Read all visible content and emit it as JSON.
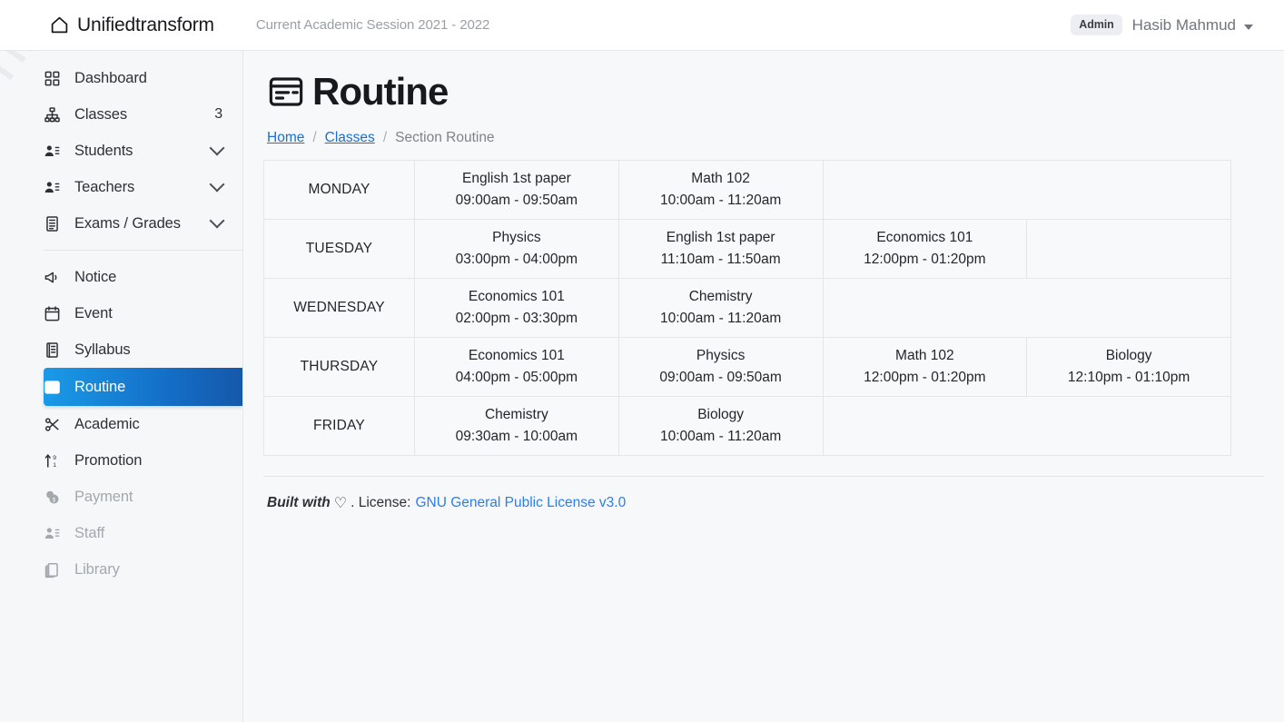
{
  "navbar": {
    "brand": "Unifiedtransform",
    "brand_icon": "home-icon",
    "session": "Current Academic Session 2021 - 2022",
    "role_badge": "Admin",
    "user_name": "Hasib Mahmud",
    "caret_icon": "chevron-down-icon"
  },
  "sidebar": {
    "watermark": "Unifiedtransform",
    "items": [
      {
        "label": "Dashboard",
        "icon": "grid-icon",
        "count": "",
        "chevron": false,
        "active": false,
        "disabled": false
      },
      {
        "label": "Classes",
        "icon": "sitemap-icon",
        "count": "3",
        "chevron": false,
        "active": false,
        "disabled": false
      },
      {
        "label": "Students",
        "icon": "users-icon",
        "count": "",
        "chevron": true,
        "active": false,
        "disabled": false
      },
      {
        "label": "Teachers",
        "icon": "users-icon",
        "count": "",
        "chevron": true,
        "active": false,
        "disabled": false
      },
      {
        "label": "Exams / Grades",
        "icon": "list-doc-icon",
        "count": "",
        "chevron": true,
        "active": false,
        "disabled": false
      },
      {
        "label": "Notice",
        "icon": "megaphone-icon",
        "count": "",
        "chevron": false,
        "active": false,
        "disabled": false
      },
      {
        "label": "Event",
        "icon": "calendar-icon",
        "count": "",
        "chevron": false,
        "active": false,
        "disabled": false
      },
      {
        "label": "Syllabus",
        "icon": "syllabus-icon",
        "count": "",
        "chevron": false,
        "active": false,
        "disabled": false
      },
      {
        "label": "Routine",
        "icon": "routine-icon",
        "count": "",
        "chevron": false,
        "active": true,
        "disabled": false
      },
      {
        "label": "Academic",
        "icon": "scissors-icon",
        "count": "",
        "chevron": false,
        "active": false,
        "disabled": false
      },
      {
        "label": "Promotion",
        "icon": "sort-up-icon",
        "count": "",
        "chevron": false,
        "active": false,
        "disabled": false
      },
      {
        "label": "Payment",
        "icon": "coins-icon",
        "count": "",
        "chevron": false,
        "active": false,
        "disabled": true
      },
      {
        "label": "Staff",
        "icon": "users-icon",
        "count": "",
        "chevron": false,
        "active": false,
        "disabled": true
      },
      {
        "label": "Library",
        "icon": "books-icon",
        "count": "",
        "chevron": false,
        "active": false,
        "disabled": true
      }
    ]
  },
  "page": {
    "title": "Routine",
    "title_icon": "routine-icon",
    "breadcrumb": [
      {
        "label": "Home",
        "link": true
      },
      {
        "label": "Classes",
        "link": true
      },
      {
        "label": "Section Routine",
        "link": false
      }
    ],
    "breadcrumb_separator": "/"
  },
  "routine": {
    "rows": [
      {
        "day": "MONDAY",
        "slots": [
          {
            "subject": "English 1st paper",
            "time": "09:00am - 09:50am"
          },
          {
            "subject": "Math 102",
            "time": "10:00am - 11:20am"
          },
          {
            "subject": "",
            "time": ""
          }
        ]
      },
      {
        "day": "TUESDAY",
        "slots": [
          {
            "subject": "Physics",
            "time": "03:00pm - 04:00pm"
          },
          {
            "subject": "English 1st paper",
            "time": "11:10am - 11:50am"
          },
          {
            "subject": "Economics 101",
            "time": "12:00pm - 01:20pm"
          },
          {
            "subject": "",
            "time": ""
          }
        ]
      },
      {
        "day": "WEDNESDAY",
        "slots": [
          {
            "subject": "Economics 101",
            "time": "02:00pm - 03:30pm"
          },
          {
            "subject": "Chemistry",
            "time": "10:00am - 11:20am"
          },
          {
            "subject": "",
            "time": ""
          }
        ]
      },
      {
        "day": "THURSDAY",
        "slots": [
          {
            "subject": "Economics 101",
            "time": "04:00pm - 05:00pm"
          },
          {
            "subject": "Physics",
            "time": "09:00am - 09:50am"
          },
          {
            "subject": "Math 102",
            "time": "12:00pm - 01:20pm"
          },
          {
            "subject": "Biology",
            "time": "12:10pm - 01:10pm"
          }
        ]
      },
      {
        "day": "FRIDAY",
        "slots": [
          {
            "subject": "Chemistry",
            "time": "09:30am - 10:00am"
          },
          {
            "subject": "Biology",
            "time": "10:00am - 11:20am"
          },
          {
            "subject": "",
            "time": ""
          }
        ]
      }
    ]
  },
  "footer": {
    "built_with": "Built with",
    "heart_icon": "heart-icon",
    "license_label": ". License:",
    "license_link": "GNU General Public License v3.0"
  },
  "colors": {
    "accent": "#1470c8",
    "link": "#2a7ef0",
    "crumb_link": "#1a6fd4",
    "page_bg": "#f7f8fa",
    "sidebar_bg": "#f6f7f9",
    "navbar_bg": "#ffffff",
    "border": "#e4e6ea",
    "muted_text": "#9aa0a8"
  }
}
